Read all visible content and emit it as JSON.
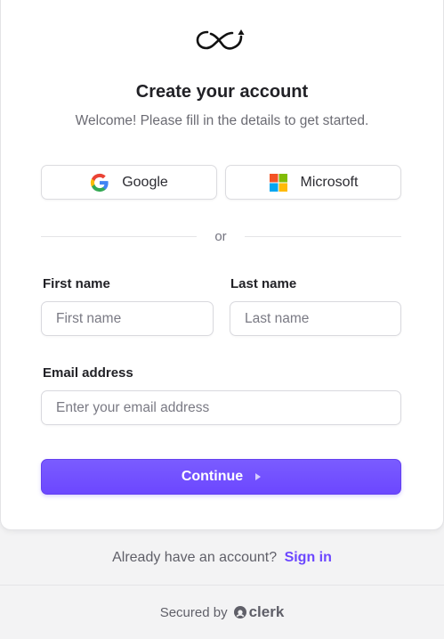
{
  "header": {
    "title": "Create your account",
    "subtitle": "Welcome! Please fill in the details to get started."
  },
  "social": {
    "google_label": "Google",
    "microsoft_label": "Microsoft"
  },
  "divider": {
    "text": "or"
  },
  "form": {
    "first_name_label": "First name",
    "first_name_placeholder": "First name",
    "last_name_label": "Last name",
    "last_name_placeholder": "Last name",
    "email_label": "Email address",
    "email_placeholder": "Enter your email address",
    "continue_label": "Continue"
  },
  "footer": {
    "prompt": "Already have an account?",
    "signin_link": "Sign in",
    "secured_by": "Secured by",
    "brand": "clerk"
  },
  "colors": {
    "accent": "#6c47ff",
    "text": "#212126",
    "muted": "#6b6b73"
  },
  "icons": [
    "app-logo-icon",
    "google-icon",
    "microsoft-icon",
    "arrow-right-icon",
    "clerk-logo-icon"
  ]
}
